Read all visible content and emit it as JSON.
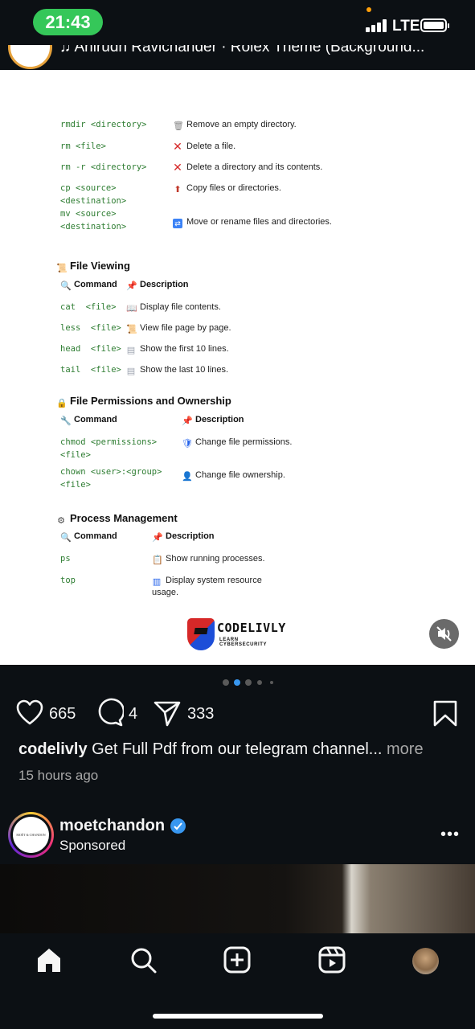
{
  "status_bar": {
    "time": "21:43",
    "network": "LTE"
  },
  "music": {
    "track": "Anirudh Ravichander · Rolex Theme (Background..."
  },
  "post_image": {
    "top_commands": [
      {
        "cmd": "rmdir <directory>",
        "desc": "Remove an empty directory.",
        "icon": "wastebasket-icon"
      },
      {
        "cmd": "rm <file>",
        "desc": "Delete a file.",
        "icon": "cross-icon"
      },
      {
        "cmd": "rm -r <directory>",
        "desc": "Delete a directory and its contents.",
        "icon": "cross-icon"
      },
      {
        "cmd": "cp <source>\n<destination>",
        "desc": "Copy files or directories.",
        "icon": "copy-icon"
      },
      {
        "cmd": "mv <source>\n<destination>",
        "desc": "Move or rename files and directories.",
        "icon": "shuffle-icon"
      }
    ],
    "file_viewing": {
      "title": "File Viewing",
      "col_command": "Command",
      "col_description": "Description",
      "rows": [
        {
          "cmd": "cat  <file>",
          "desc": "Display file contents."
        },
        {
          "cmd": "less  <file>",
          "desc": "View file page by page."
        },
        {
          "cmd": "head  <file>",
          "desc": "Show the first 10 lines."
        },
        {
          "cmd": "tail  <file>",
          "desc": "Show the last 10 lines."
        }
      ]
    },
    "permissions": {
      "title": "File Permissions and Ownership",
      "col_command": "Command",
      "col_description": "Description",
      "rows": [
        {
          "cmd": "chmod <permissions>\n<file>",
          "desc": "Change file permissions."
        },
        {
          "cmd": "chown <user>:<group>\n<file>",
          "desc": "Change file ownership."
        }
      ]
    },
    "process": {
      "title": "Process Management",
      "col_command": "Command",
      "col_description": "Description",
      "rows": [
        {
          "cmd": "ps",
          "desc": "Show running processes."
        },
        {
          "cmd": "top",
          "desc": "Display system resource",
          "desc2": "usage."
        }
      ]
    },
    "logo": {
      "word": "CODELIVLY",
      "sub": "LEARN CYBERSECURITY"
    }
  },
  "actions": {
    "likes": "665",
    "comments": "4",
    "shares": "333"
  },
  "caption": {
    "user": "codelivly",
    "text": "Get Full Pdf from our telegram channel...",
    "more": "more"
  },
  "time_ago": "15 hours ago",
  "next_post": {
    "user": "moetchandon",
    "label": "Sponsored",
    "avatar_text": "MOËT & CHANDON"
  }
}
